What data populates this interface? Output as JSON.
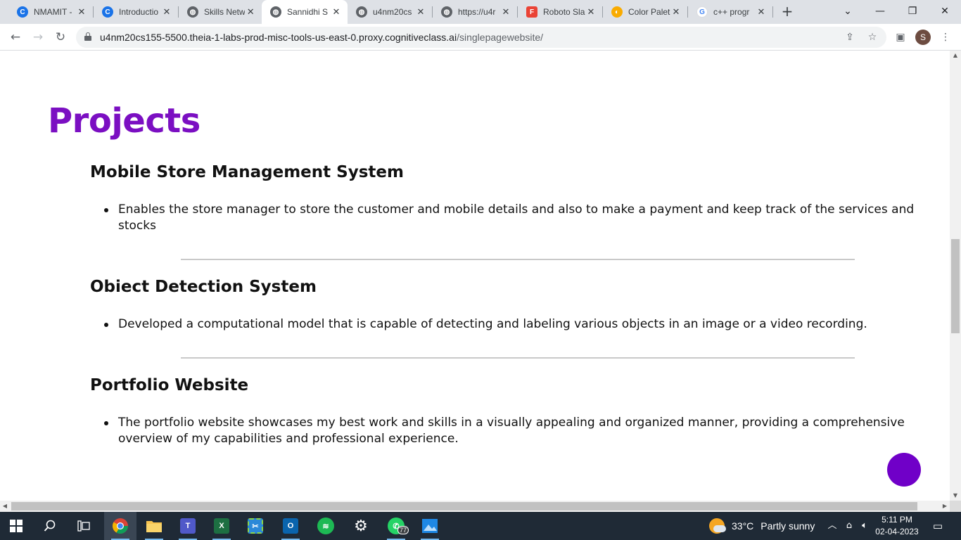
{
  "browser": {
    "tabs": [
      {
        "label": "NMAMIT -",
        "icon": "coursera-icon",
        "color": "#1a73e8",
        "glyph": "C"
      },
      {
        "label": "Introductio",
        "icon": "coursera-icon",
        "color": "#1a73e8",
        "glyph": "C"
      },
      {
        "label": "Skills Netw",
        "icon": "globe-icon",
        "color": "#5f6368",
        "glyph": "◍"
      },
      {
        "label": "Sannidhi S",
        "icon": "globe-icon",
        "color": "#5f6368",
        "glyph": "◍",
        "active": true
      },
      {
        "label": "u4nm20cs",
        "icon": "globe-icon",
        "color": "#5f6368",
        "glyph": "◍"
      },
      {
        "label": "https://u4r",
        "icon": "globe-icon",
        "color": "#5f6368",
        "glyph": "◍"
      },
      {
        "label": "Roboto Sla",
        "icon": "google-fonts-icon",
        "color": "#ea4335",
        "glyph": "F"
      },
      {
        "label": "Color Palet",
        "icon": "palette-icon",
        "color": "#f9ab00",
        "glyph": "◐"
      },
      {
        "label": "c++ progr",
        "icon": "google-icon",
        "color": "#4285f4",
        "glyph": "G"
      }
    ],
    "url_host": "u4nm20cs155-5500.theia-1-labs-prod-misc-tools-us-east-0.proxy.cognitiveclass.ai",
    "url_path": "/singlepagewebsite/",
    "profile_initial": "S"
  },
  "page": {
    "title": "Projects",
    "projects": [
      {
        "title": "Mobile Store Management System",
        "description": "Enables the store manager to store the customer and mobile details and also to make a payment and keep track of the services and stocks"
      },
      {
        "title": "Obiect Detection System",
        "description": "Developed a computational model that is capable of detecting and labeling various objects in an image or a video recording."
      },
      {
        "title": "Portfolio Website",
        "description": "The portfolio website showcases my best work and skills in a visually appealing and organized manner, providing a comprehensive overview of my capabilities and professional experience."
      }
    ],
    "accent_color": "#7b0fc2"
  },
  "taskbar": {
    "weather_temp": "33°C",
    "weather_condition": "Partly sunny",
    "time": "5:11 PM",
    "date": "02-04-2023",
    "whatsapp_badge": "77"
  }
}
